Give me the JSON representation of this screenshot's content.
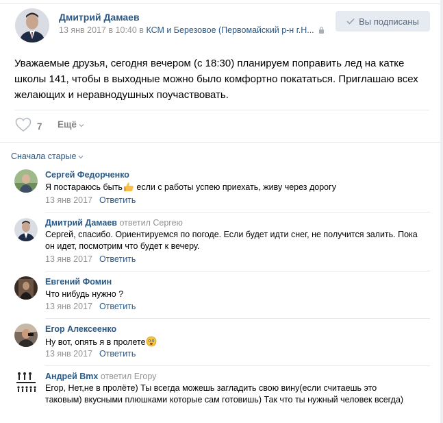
{
  "post": {
    "author": "Дмитрий Дамаев",
    "date": "13 янв 2017 в 10:40 в",
    "location": "КСМ и Березовое (Первомайский р-н г.Н...",
    "subscribe_label": "Вы подписаны",
    "text": "Уважаемые друзья, сегодня вечером (с 18:30) планируем поправить лед на катке школы 141, чтобы в выходные можно было комфортно покататься. Приглашаю всех желающих и неравнодушных поучаствовать.",
    "likes": "7",
    "more_label": "Ещё"
  },
  "sort_label": "Сначала старые",
  "comments": [
    {
      "name": "Сергей Федорченко",
      "replied_to": "",
      "text_before": "Я постараюсь быть",
      "text_after": " если с работы успею приехать, живу через дорогу",
      "date": "13 янв 2017",
      "reply_label": "Ответить"
    },
    {
      "name": "Дмитрий Дамаев",
      "replied_to": "ответил Сергею",
      "text": "Сергей, спасибо. Ориентируемся по погоде. Если будет идти снег, не получится залить. Пока он идет, посмотрим что будет к вечеру.",
      "date": "13 янв 2017",
      "reply_label": "Ответить"
    },
    {
      "name": "Евгений Фомин",
      "replied_to": "",
      "text": "Что нибудь нужно ?",
      "date": "13 янв 2017",
      "reply_label": "Ответить"
    },
    {
      "name": "Егор Алексеенко",
      "replied_to": "",
      "text": "Ну вот, опять я в пролете",
      "date": "13 янв 2017",
      "reply_label": "Ответить"
    },
    {
      "name": "Андрей Bmx",
      "replied_to": "ответил Егору",
      "text": "Егор, Нет,не в пролёте) Ты всегда можешь загладить свою вину(если считаешь это таковым) вкусными плюшками которые сам готовишь) Так что ты нужный человек всегда)"
    }
  ],
  "colors": {
    "link": "#2a5885",
    "muted": "#939393",
    "button_bg": "#e5ebf1",
    "divider": "#e7e8ec"
  }
}
